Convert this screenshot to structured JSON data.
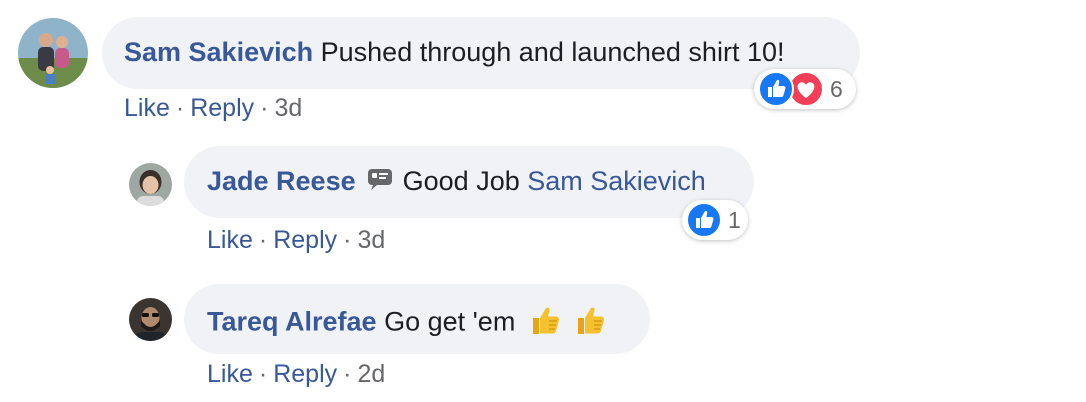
{
  "comments": [
    {
      "author": "Sam Sakievich",
      "text": "Pushed through and launched shirt 10!",
      "actions": {
        "like": "Like",
        "reply": "Reply",
        "time": "3d"
      },
      "reactions": {
        "icons": [
          "like-icon",
          "love-icon"
        ],
        "count": "6"
      }
    },
    {
      "author": "Jade Reese",
      "badge_icon": "conversation-starter-icon",
      "text": "Good Job",
      "mention": "Sam Sakievich",
      "actions": {
        "like": "Like",
        "reply": "Reply",
        "time": "3d"
      },
      "reactions": {
        "icons": [
          "like-icon"
        ],
        "count": "1"
      }
    },
    {
      "author": "Tareq Alrefae",
      "text": "Go get 'em",
      "emojis": [
        "thumbs-up-emoji",
        "thumbs-up-emoji"
      ],
      "actions": {
        "like": "Like",
        "reply": "Reply",
        "time": "2d"
      }
    }
  ],
  "separator": "·",
  "colors": {
    "link": "#385898",
    "bubble": "#f0f2f5",
    "text": "#1c1e21",
    "meta": "#65676b",
    "like_blue": "#1877f2",
    "love_red": "#f33e58"
  }
}
